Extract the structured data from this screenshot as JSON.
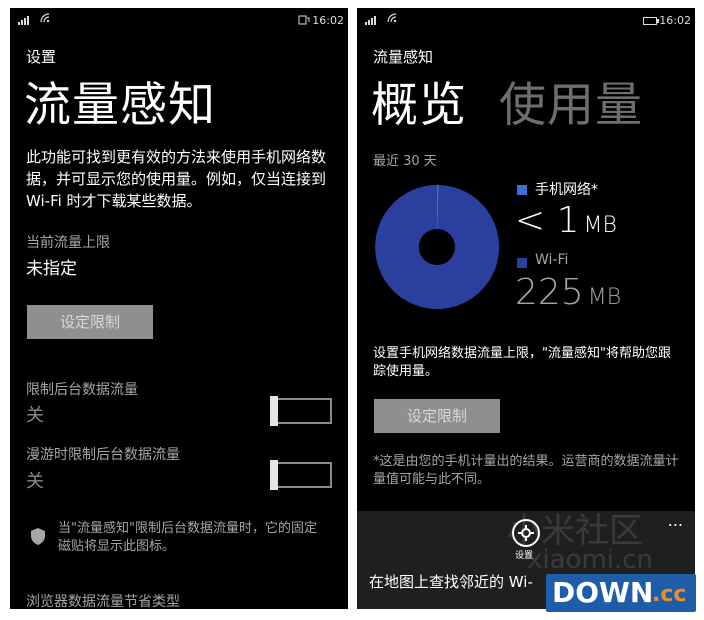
{
  "left": {
    "status_time": "16:02",
    "header_small": "设置",
    "title": "流量感知",
    "description": "此功能可找到更有效的方法来使用手机网络数据，并可显示您的使用量。例如，仅当连接到 Wi-Fi 时才下载某些数据。",
    "current_limit_label": "当前流量上限",
    "current_limit_value": "未指定",
    "set_limit_button": "设定限制",
    "restrict_bg_label": "限制后台数据流量",
    "restrict_bg_value": "关",
    "restrict_roaming_label": "漫游时限制后台数据流量",
    "restrict_roaming_value": "关",
    "shield_note": "当\"流量感知\"限制后台数据流量时，它的固定磁贴将显示此图标。",
    "browser_saving_label": "浏览器数据流量节省类型"
  },
  "right": {
    "status_time": "16:02",
    "header_small": "流量感知",
    "pivot_active": "概览",
    "pivot_inactive": "使用量",
    "period_label": "最近 30 天",
    "legend": [
      {
        "name": "手机网络*",
        "value": "< 1",
        "unit": "MB",
        "color": "#3d6fd9"
      },
      {
        "name": "Wi-Fi",
        "value": "225",
        "unit": "MB",
        "color": "#2b3f9e"
      }
    ],
    "description": "设置手机网络数据流量上限，\"流量感知\"将帮助您跟踪使用量。",
    "set_limit_button": "设定限制",
    "footnote": "*这是由您的手机计量出的结果。运营商的数据流量计量值可能与此不同。",
    "appbar_settings_label": "设置",
    "appbar_more": "...",
    "bottom_tip": "在地图上查找邻近的 Wi-",
    "watermark_cn": "小米社区",
    "watermark_en": "xiaomi.cn"
  },
  "chart_data": {
    "type": "pie",
    "categories": [
      "手机网络*",
      "Wi-Fi"
    ],
    "values": [
      1,
      225
    ],
    "colors": [
      "#3d6fd9",
      "#2b3f9e"
    ]
  },
  "logo_text": {
    "main": "DOWN",
    "suffix": ".cc"
  }
}
